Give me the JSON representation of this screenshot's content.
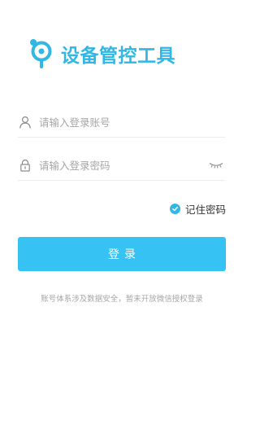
{
  "colors": {
    "brand": "#30b7e5",
    "button": "#36c2f2",
    "placeholder": "#a6a6a6",
    "divider": "#ececec"
  },
  "header": {
    "logo_icon": "location-pin-logo-icon",
    "app_title": "设备管控工具"
  },
  "form": {
    "username": {
      "icon": "user-icon",
      "value": "",
      "placeholder": "请输入登录账号"
    },
    "password": {
      "icon": "lock-icon",
      "value": "",
      "placeholder": "请输入登录密码",
      "visibility_icon": "eye-closed-icon"
    },
    "remember": {
      "label": "记住密码",
      "checked": true,
      "icon": "check-icon"
    },
    "login_label": "登录"
  },
  "footer": {
    "notice": "账号体系涉及数据安全，暂未开放微信授权登录"
  }
}
